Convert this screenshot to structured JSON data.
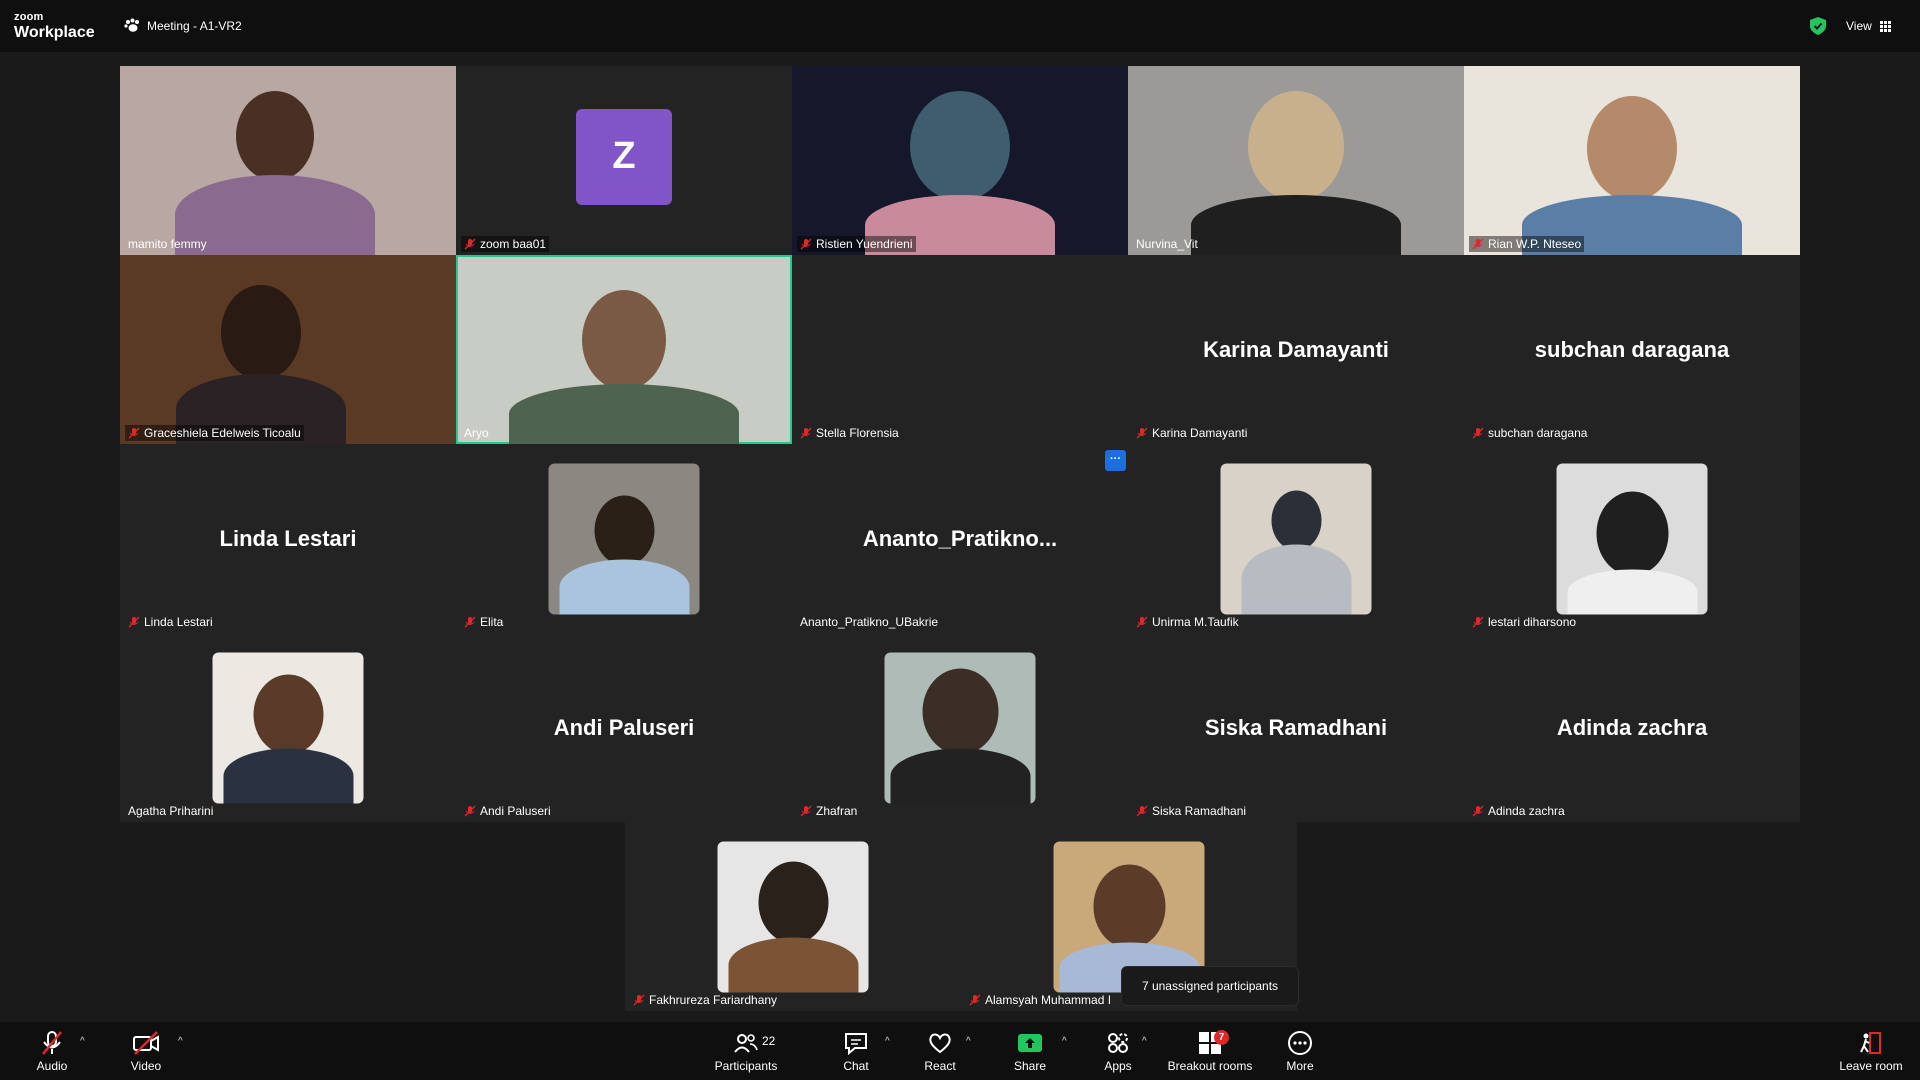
{
  "app": {
    "logo_small": "zoom",
    "logo_big": "Workplace",
    "meeting_title": "Meeting - A1-VR2",
    "view_label": "View"
  },
  "colors": {
    "active_speaker_border": "#22c98a",
    "avatar_z": "#8155c8",
    "breakout_badge": "#e02828",
    "share_green": "#22c55e"
  },
  "tiles": [
    {
      "name": "mamito femmy",
      "muted": false,
      "type": "video"
    },
    {
      "name": "zoom baa01",
      "muted": true,
      "type": "avatar",
      "avatar_letter": "Z"
    },
    {
      "name": "Ristien Yuendrieni",
      "muted": true,
      "type": "video"
    },
    {
      "name": "Nurvina_Vit",
      "muted": false,
      "type": "video"
    },
    {
      "name": "Rian W.P. Nteseo",
      "muted": true,
      "type": "video"
    },
    {
      "name": "Graceshiela Edelweis Ticoalu",
      "muted": true,
      "type": "video"
    },
    {
      "name": "Aryo",
      "muted": false,
      "type": "video",
      "active": true
    },
    {
      "name": "Stella Florensia",
      "muted": true,
      "type": "blank"
    },
    {
      "name": "Karina Damayanti",
      "muted": true,
      "type": "name",
      "display": "Karina Damayanti"
    },
    {
      "name": "subchan daragana",
      "muted": true,
      "type": "name",
      "display": "subchan daragana"
    },
    {
      "name": "Linda Lestari",
      "muted": true,
      "type": "name",
      "display": "Linda Lestari"
    },
    {
      "name": "Elita",
      "muted": true,
      "type": "photo"
    },
    {
      "name": "Ananto_Pratikno_UBakrie",
      "muted": false,
      "type": "name",
      "display": "Ananto_Pratikno..."
    },
    {
      "name": "Unirma M.Taufik",
      "muted": true,
      "type": "photo"
    },
    {
      "name": "lestari diharsono",
      "muted": true,
      "type": "photo"
    },
    {
      "name": "Agatha Priharini",
      "muted": false,
      "type": "photo"
    },
    {
      "name": "Andi Paluseri",
      "muted": true,
      "type": "name",
      "display": "Andi Paluseri"
    },
    {
      "name": "Zhafran",
      "muted": true,
      "type": "photo"
    },
    {
      "name": "Siska Ramadhani",
      "muted": true,
      "type": "name",
      "display": "Siska Ramadhani"
    },
    {
      "name": "Adinda zachra",
      "muted": true,
      "type": "name",
      "display": "Adinda zachra"
    },
    {
      "name": "Fakhrureza Fariardhany",
      "muted": true,
      "type": "photo"
    },
    {
      "name": "Alamsyah Muhammad I",
      "muted": true,
      "type": "photo"
    }
  ],
  "more_dot": "···",
  "tooltip": "7 unassigned participants",
  "toolbar": {
    "audio": "Audio",
    "video": "Video",
    "participants": "Participants",
    "participants_count": "22",
    "chat": "Chat",
    "react": "React",
    "share": "Share",
    "apps": "Apps",
    "breakout": "Breakout rooms",
    "breakout_badge": "7",
    "more": "More",
    "leave": "Leave room"
  }
}
